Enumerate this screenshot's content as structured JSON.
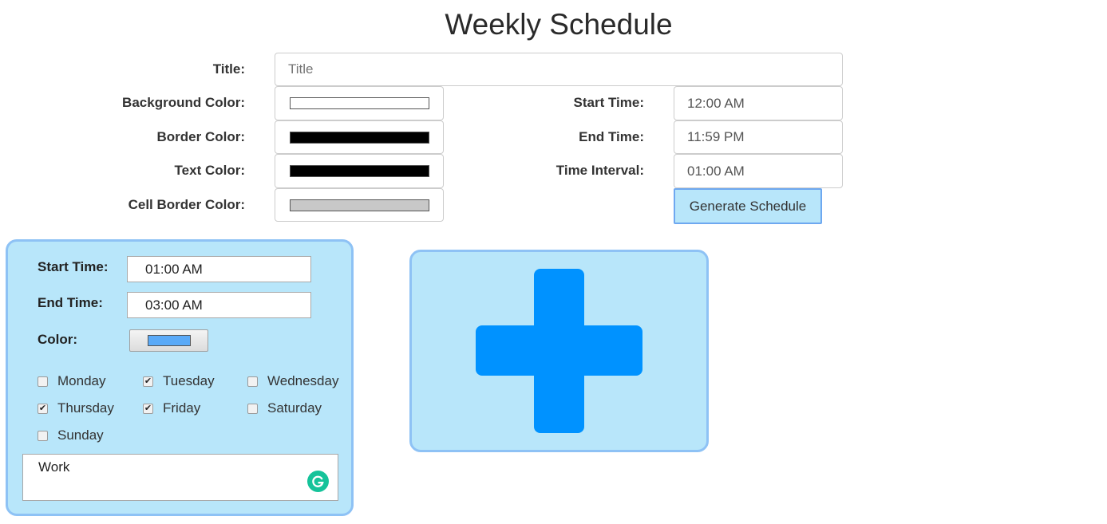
{
  "header": {
    "title": "Weekly Schedule"
  },
  "settings": {
    "title": {
      "label": "Title:",
      "placeholder": "Title",
      "value": ""
    },
    "background_color": {
      "label": "Background Color:",
      "value": "#ffffff"
    },
    "border_color": {
      "label": "Border Color:",
      "value": "#000000"
    },
    "text_color": {
      "label": "Text Color:",
      "value": "#000000"
    },
    "cell_border_color": {
      "label": "Cell Border Color:",
      "value": "#c8c8c8"
    },
    "start_time": {
      "label": "Start Time:",
      "value": "12:00 AM"
    },
    "end_time": {
      "label": "End Time:",
      "value": "11:59 PM"
    },
    "time_interval": {
      "label": "Time Interval:",
      "value": "01:00 AM"
    },
    "generate_label": "Generate Schedule"
  },
  "event": {
    "start_time": {
      "label": "Start Time:",
      "value": "01:00 AM"
    },
    "end_time": {
      "label": "End Time:",
      "value": "03:00 AM"
    },
    "color": {
      "label": "Color:",
      "value": "#5aaaf8"
    },
    "days": [
      {
        "label": "Monday",
        "checked": false
      },
      {
        "label": "Tuesday",
        "checked": true
      },
      {
        "label": "Wednesday",
        "checked": false
      },
      {
        "label": "Thursday",
        "checked": true
      },
      {
        "label": "Friday",
        "checked": true
      },
      {
        "label": "Saturday",
        "checked": false
      },
      {
        "label": "Sunday",
        "checked": false
      }
    ],
    "notes": "Work",
    "grammarly_icon": "grammarly-icon"
  },
  "add_event": {
    "icon": "plus-icon"
  },
  "colors": {
    "card_bg": "#b8e6fa",
    "card_border": "#8ec2f5",
    "plus": "#0092ff",
    "accent_border": "#6ea8f0"
  }
}
